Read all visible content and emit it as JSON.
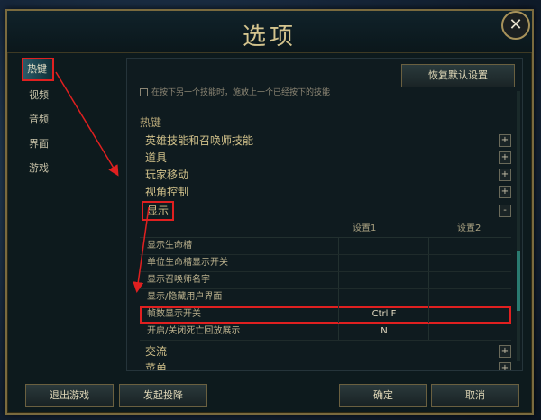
{
  "window": {
    "title": "选项",
    "close_glyph": "✕"
  },
  "sidebar": {
    "items": [
      {
        "label": "热键",
        "active": true
      },
      {
        "label": "视频"
      },
      {
        "label": "音频"
      },
      {
        "label": "界面"
      },
      {
        "label": "游戏"
      }
    ]
  },
  "content": {
    "reset_label": "恢复默认设置",
    "note": "在按下另一个技能时，施放上一个已经按下的技能",
    "section_title": "热键",
    "groups": [
      {
        "label": "英雄技能和召唤师技能",
        "toggle": "+"
      },
      {
        "label": "道具",
        "toggle": "+"
      },
      {
        "label": "玩家移动",
        "toggle": "+"
      },
      {
        "label": "视角控制",
        "toggle": "+"
      },
      {
        "label": "显示",
        "toggle": "-"
      }
    ],
    "table": {
      "headers": [
        "",
        "设置1",
        "设置2"
      ],
      "rows": [
        {
          "label": "显示生命槽",
          "key1": "",
          "key2": ""
        },
        {
          "label": "单位生命槽显示开关",
          "key1": "",
          "key2": ""
        },
        {
          "label": "显示召唤师名字",
          "key1": "",
          "key2": ""
        },
        {
          "label": "显示/隐藏用户界面",
          "key1": "",
          "key2": ""
        },
        {
          "label": "帧数显示开关",
          "key1": "Ctrl F",
          "key2": ""
        },
        {
          "label": "开启/关闭死亡回放展示",
          "key1": "N",
          "key2": ""
        }
      ]
    },
    "after_groups": [
      {
        "label": "交流",
        "toggle": "+"
      },
      {
        "label": "菜单",
        "toggle": "+"
      }
    ]
  },
  "footer": {
    "quit_label": "退出游戏",
    "report_label": "发起投降",
    "ok_label": "确定",
    "cancel_label": "取消"
  },
  "colors": {
    "accent": "#d4c48e",
    "annotation": "#e02020"
  }
}
